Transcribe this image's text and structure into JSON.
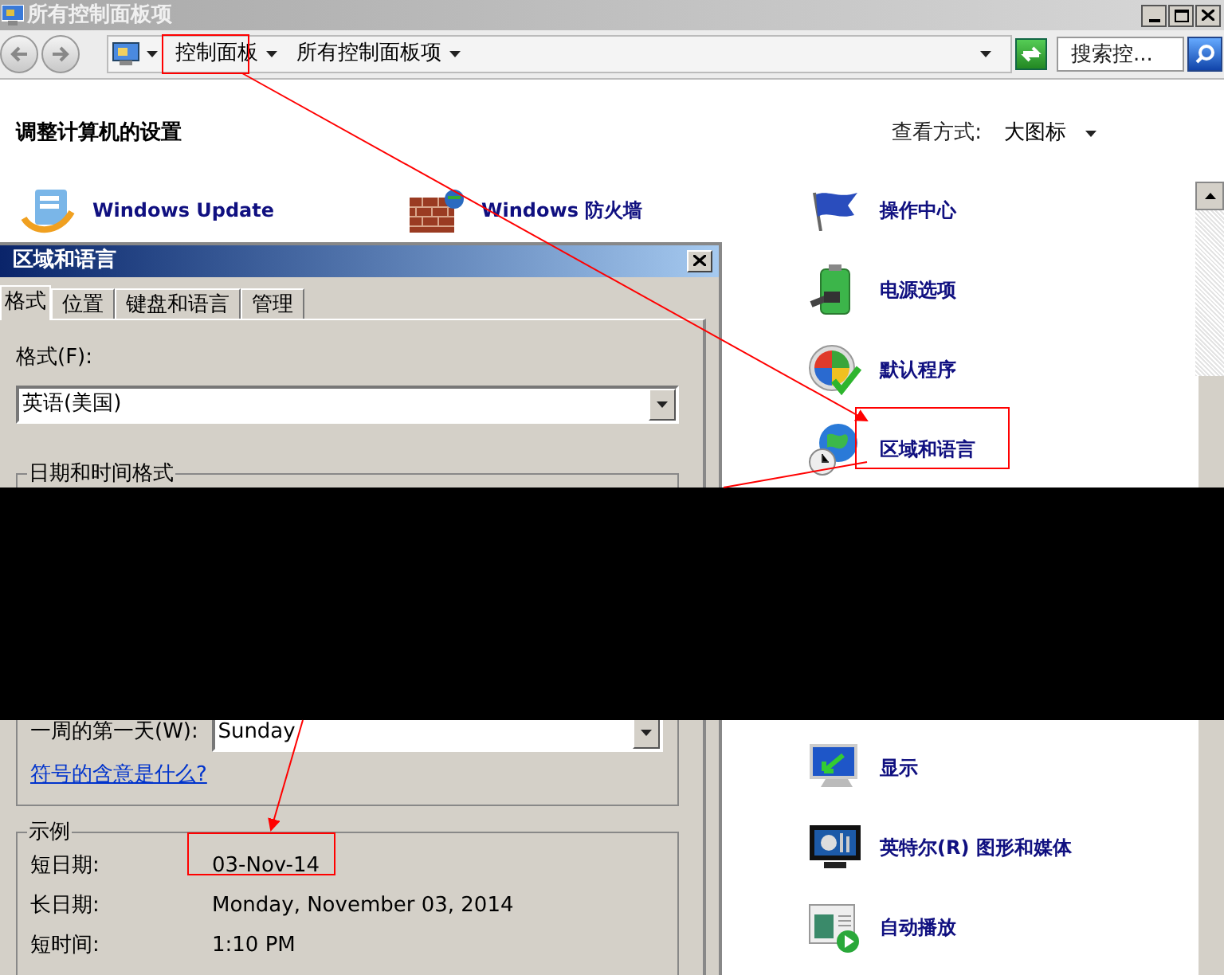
{
  "window": {
    "title": "所有控制面板项"
  },
  "address_bar": {
    "breadcrumbs": [
      "控制面板",
      "所有控制面板项"
    ],
    "search": {
      "placeholder": "搜索控..."
    }
  },
  "heading": "调整计算机的设置",
  "view": {
    "label": "查看方式:",
    "value": "大图标"
  },
  "items": {
    "column_1": [
      {
        "label": "Windows Update"
      }
    ],
    "column_2": [
      {
        "label": "Windows 防火墙"
      }
    ],
    "column_3_above_redaction": [
      {
        "label": "操作中心"
      },
      {
        "label": "电源选项"
      },
      {
        "label": "默认程序"
      },
      {
        "label": "区域和语言"
      }
    ],
    "column_3_below_redaction": [
      {
        "label": "显示"
      },
      {
        "label": "英特尔(R) 图形和媒体"
      },
      {
        "label": "自动播放"
      }
    ]
  },
  "dialog": {
    "title": "区域和语言",
    "tabs": [
      {
        "label": "格式",
        "selected": true
      },
      {
        "label": "位置",
        "selected": false
      },
      {
        "label": "键盘和语言",
        "selected": false
      },
      {
        "label": "管理",
        "selected": false
      }
    ],
    "format_label": "格式(F):",
    "format_value": "英语(美国)",
    "datetime_group": "日期和时间格式",
    "first_day_label": "一周的第一天(W):",
    "first_day_value": "Sunday",
    "link": "符号的含意是什么?",
    "example_group": "示例",
    "examples": [
      {
        "label": "短日期:",
        "value": "03-Nov-14"
      },
      {
        "label": "长日期:",
        "value": "Monday, November 03, 2014"
      },
      {
        "label": "短时间:",
        "value": "1:10 PM"
      }
    ]
  }
}
